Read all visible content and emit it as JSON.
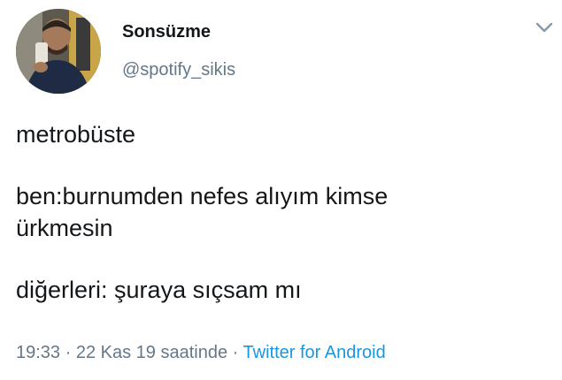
{
  "user": {
    "display_name": "Sonsüzme",
    "handle": "@spotify_sikis",
    "avatar_icon": "profile-photo"
  },
  "menu": {
    "icon": "chevron-down-icon"
  },
  "tweet": {
    "paragraphs": [
      "metrobüste",
      "ben:burnumden nefes alıyım kimse\nürkmesin",
      "diğerleri: şuraya sıçsam mı"
    ]
  },
  "meta": {
    "time": "19:33",
    "separator": "·",
    "date": "22 Kas 19 saatinde",
    "source": "Twitter for Android"
  },
  "colors": {
    "text": "#14171a",
    "secondary": "#657786",
    "link": "#1b95e0"
  }
}
